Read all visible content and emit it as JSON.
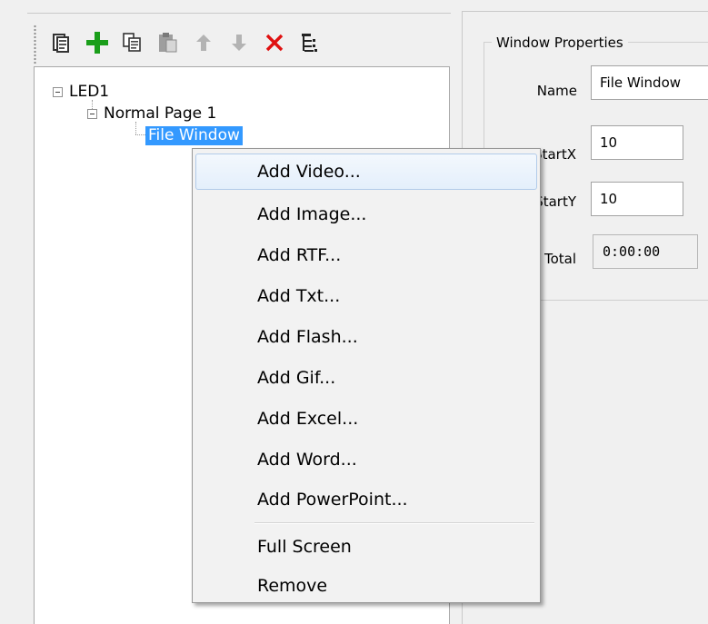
{
  "toolbar": {
    "buttons": [
      {
        "icon": "new-program-icon",
        "color": "#3c3c3c"
      },
      {
        "icon": "add-icon",
        "color": "#1a9e1a"
      },
      {
        "icon": "copy-icon",
        "color": "#3c3c3c"
      },
      {
        "icon": "paste-icon",
        "color": "#b5b5b5"
      },
      {
        "icon": "move-up-icon",
        "color": "#b5b5b5"
      },
      {
        "icon": "move-down-icon",
        "color": "#b5b5b5"
      },
      {
        "icon": "delete-icon",
        "color": "#e01010"
      },
      {
        "icon": "tree-view-icon",
        "color": "#3c3c3c"
      }
    ]
  },
  "tree": {
    "root": "LED1",
    "page": "Normal Page 1",
    "window": "File Window"
  },
  "context_menu": {
    "items": [
      "Add Video...",
      "Add Image...",
      "Add RTF...",
      "Add Txt...",
      "Add Flash...",
      "Add Gif...",
      "Add Excel...",
      "Add Word...",
      "Add PowerPoint..."
    ],
    "extra_items": [
      "Full Screen",
      "Remove"
    ],
    "highlighted_index": 0
  },
  "properties": {
    "group_title": "Window Properties",
    "name_label": "Name",
    "name_value": "File Window",
    "startx_label": "StartX",
    "startx_value": "10",
    "starty_label": "StartY",
    "starty_value": "10",
    "total_label": "Total",
    "total_value": "0:00:00"
  },
  "colors": {
    "selection": "#3399ff",
    "menu_highlight_border": "#b1cbe9"
  }
}
